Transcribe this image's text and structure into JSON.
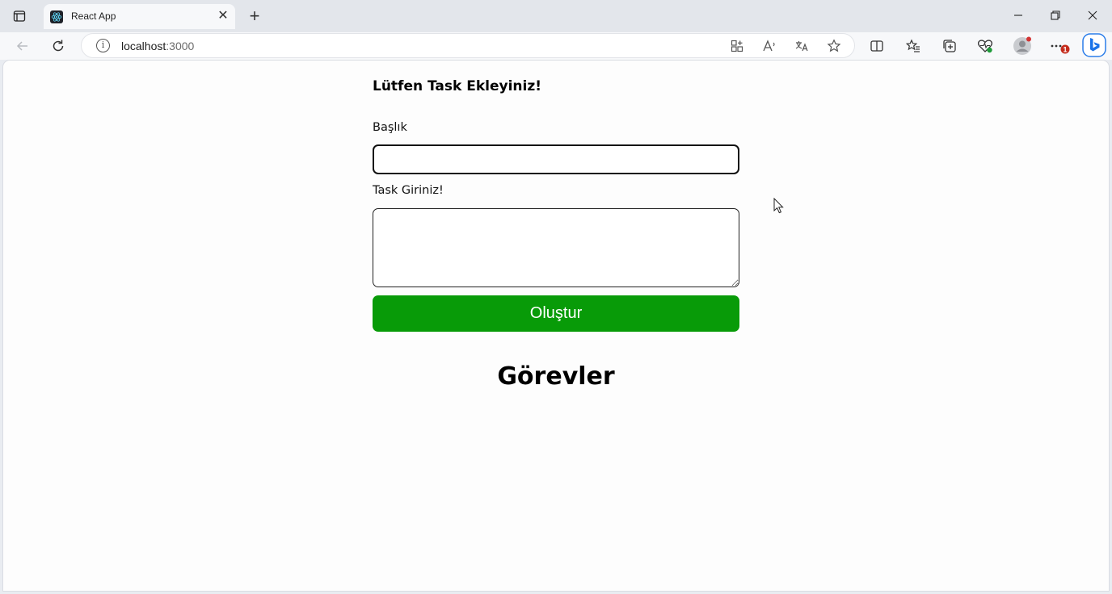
{
  "browser": {
    "tab": {
      "title": "React App",
      "close_glyph": "✕"
    },
    "new_tab_glyph": "+",
    "window_controls": {
      "minimize": "—",
      "restore": "❐",
      "close": "✕"
    },
    "address_bar": {
      "host": "localhost",
      "port": ":3000"
    },
    "icons": {
      "back": "back-arrow-icon",
      "reload": "reload-icon",
      "info": "info-icon",
      "apps": "apps-icon",
      "read_aloud": "read-aloud-icon",
      "translate": "translate-icon",
      "favorite": "star-icon",
      "split_screen": "split-screen-icon",
      "favorites": "favorites-icon",
      "collections": "collections-icon",
      "performance": "heartbeat-icon",
      "profile": "profile-icon",
      "more": "more-icon",
      "copilot": "bing-icon"
    },
    "notification_badge": "1",
    "colors": {
      "tab_strip": "#e3e6eb",
      "toolbar": "#f7f8fa",
      "page": "#fdfdfd"
    }
  },
  "form": {
    "heading": "Lütfen Task Ekleyiniz!",
    "title_label": "Başlık",
    "title_value": "",
    "task_label": "Task Giriniz!",
    "task_value": "",
    "submit_label": "Oluştur",
    "submit_color": "#089b08"
  },
  "tasks": {
    "title": "Görevler",
    "items": []
  }
}
